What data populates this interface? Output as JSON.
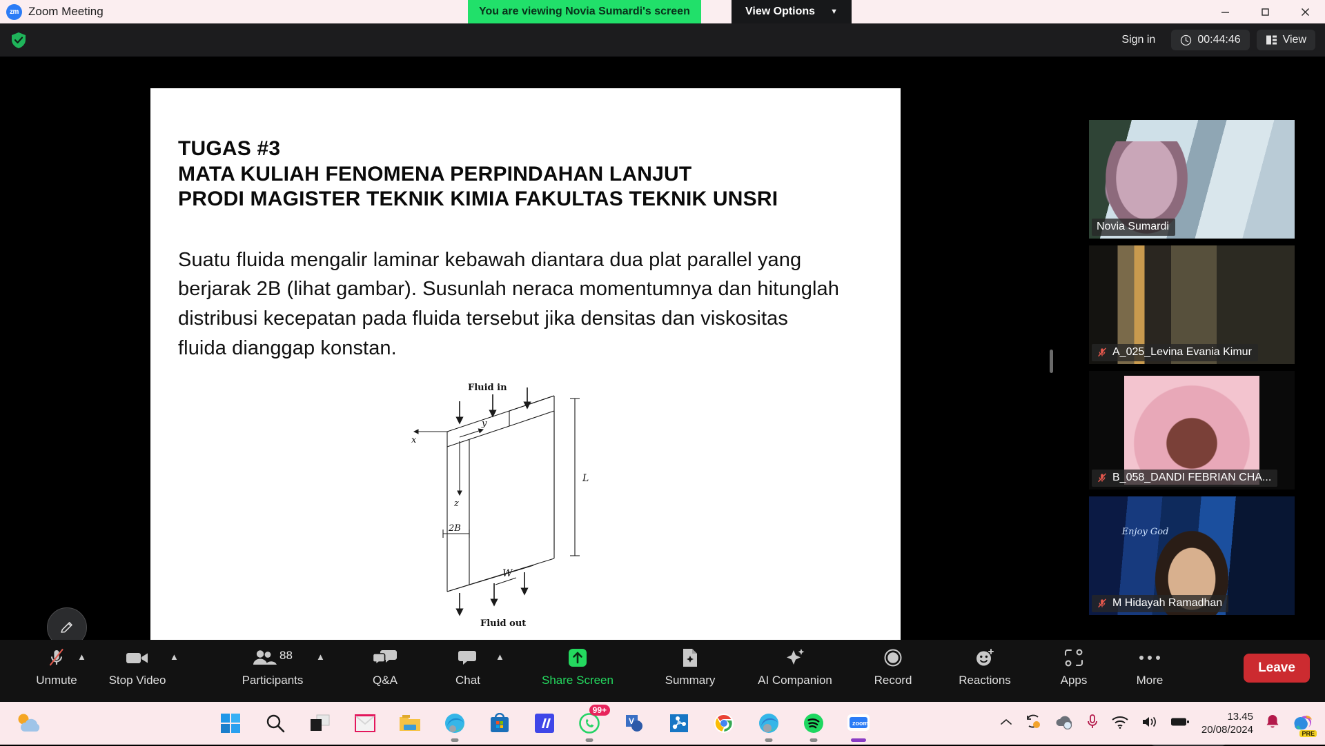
{
  "titlebar": {
    "app_title": "Zoom Meeting",
    "logo_text": "zm",
    "share_banner": "You are viewing Novia Sumardi's screen",
    "view_options_label": "View Options",
    "view_options_chevron": "chevron-down",
    "window_minimize": "─",
    "window_maximize": "❐",
    "window_close": "✕"
  },
  "meeting_header": {
    "encryption_icon": "shield-check-icon",
    "sign_in_label": "Sign in",
    "timer_icon": "clock-icon",
    "timer_value": "00:44:46",
    "view_icon": "layout-icon",
    "view_label": "View"
  },
  "slide": {
    "heading_lines": [
      "TUGAS #3",
      "MATA KULIAH FENOMENA PERPINDAHAN LANJUT",
      "PRODI MAGISTER TEKNIK KIMIA FAKULTAS TEKNIK UNSRI"
    ],
    "heading_line1": "TUGAS #3",
    "heading_line2": "MATA KULIAH FENOMENA PERPINDAHAN LANJUT",
    "heading_line3": "PRODI MAGISTER TEKNIK KIMIA FAKULTAS TEKNIK UNSRI",
    "body_text": "Suatu fluida mengalir laminar kebawah diantara dua plat parallel yang berjarak 2B (lihat gambar). Susunlah neraca momentumnya dan hitunglah distribusi kecepatan pada fluida tersebut jika densitas dan viskositas fluida dianggap konstan.",
    "diagram": {
      "label_fluid_in": "Fluid in",
      "label_fluid_out": "Fluid out",
      "label_x": "x",
      "label_y": "y",
      "label_z": "z",
      "label_L": "L",
      "label_2B": "2B",
      "label_W": "W"
    }
  },
  "participants_panel": {
    "tiles": [
      {
        "name": "Novia Sumardi",
        "muted": false,
        "active_speaker": true
      },
      {
        "name": "A_025_Levina Evania Kimur",
        "muted": true,
        "active_speaker": false
      },
      {
        "name": "B_058_DANDI FEBRIAN CHA...",
        "muted": true,
        "active_speaker": false
      },
      {
        "name": "M Hidayah Ramadhan",
        "muted": true,
        "active_speaker": false
      }
    ],
    "scroll_down_icon": "chevron-down-icon",
    "virtual_bg_text": "Enjoy God"
  },
  "annotate": {
    "icon": "pencil-icon"
  },
  "toolbar": {
    "items": [
      {
        "label": "Unmute",
        "icon": "mic-muted-icon",
        "caret": true,
        "green": false
      },
      {
        "label": "Stop Video",
        "icon": "video-camera-icon",
        "caret": true,
        "green": false
      },
      {
        "label": "Participants",
        "icon": "people-icon",
        "caret": true,
        "green": false,
        "count": "88"
      },
      {
        "label": "Q&A",
        "icon": "qa-bubbles-icon",
        "caret": false,
        "green": false
      },
      {
        "label": "Chat",
        "icon": "chat-bubble-icon",
        "caret": true,
        "green": false
      },
      {
        "label": "Share Screen",
        "icon": "share-screen-icon",
        "caret": false,
        "green": true
      },
      {
        "label": "Summary",
        "icon": "summary-doc-icon",
        "caret": false,
        "green": false
      },
      {
        "label": "AI Companion",
        "icon": "ai-sparkle-icon",
        "caret": false,
        "green": false
      },
      {
        "label": "Record",
        "icon": "record-circle-icon",
        "caret": false,
        "green": false
      },
      {
        "label": "Reactions",
        "icon": "reactions-smiley-icon",
        "caret": false,
        "green": false
      },
      {
        "label": "Apps",
        "icon": "apps-icon",
        "caret": false,
        "green": false
      },
      {
        "label": "More",
        "icon": "more-dots-icon",
        "caret": false,
        "green": false
      }
    ],
    "leave_label": "Leave"
  },
  "taskbar": {
    "apps": [
      {
        "name": "start-windows",
        "running": false,
        "badge": ""
      },
      {
        "name": "search",
        "running": false,
        "badge": ""
      },
      {
        "name": "task-view",
        "running": false,
        "badge": ""
      },
      {
        "name": "mail",
        "running": false,
        "badge": ""
      },
      {
        "name": "file-explorer",
        "running": false,
        "badge": ""
      },
      {
        "name": "microsoft-edge",
        "running": true,
        "badge": ""
      },
      {
        "name": "microsoft-store",
        "running": false,
        "badge": ""
      },
      {
        "name": "mendeley",
        "running": false,
        "badge": ""
      },
      {
        "name": "whatsapp",
        "running": true,
        "badge": "99+"
      },
      {
        "name": "visio",
        "running": false,
        "badge": ""
      },
      {
        "name": "chemdraw",
        "running": false,
        "badge": ""
      },
      {
        "name": "google-chrome",
        "running": false,
        "badge": ""
      },
      {
        "name": "edge-profile",
        "running": true,
        "badge": ""
      },
      {
        "name": "spotify",
        "running": true,
        "badge": ""
      },
      {
        "name": "zoom",
        "running": true,
        "badge": ""
      }
    ],
    "tray": {
      "overflow_icon": "chevron-up-icon",
      "sync_icon": "onedrive-sync-icon",
      "cloud_icon": "cloud-sync-icon",
      "mic_icon": "microphone-icon",
      "wifi_icon": "wifi-icon",
      "volume_icon": "speaker-icon",
      "battery_icon": "battery-icon",
      "time": "13.45",
      "date": "20/08/2024",
      "notification_icon": "bell-icon",
      "copilot_icon": "copilot-icon",
      "copilot_badge": "PRE"
    }
  },
  "colors": {
    "share_banner_green": "#21e06a",
    "share_screen_green": "#24d95f",
    "leave_red": "#cc2b30",
    "active_speaker_border": "#b9f227",
    "taskbar_pink": "#fbe9ec",
    "toolbar_dark": "#121212"
  }
}
